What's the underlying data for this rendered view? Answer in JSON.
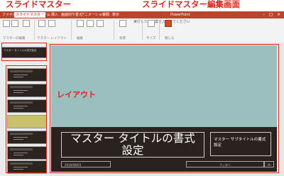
{
  "annotations": {
    "slide_master": "スライドマスター",
    "slide_master_editor": "スライドマスター編集画面",
    "layout": "レイアウト"
  },
  "ribbon": {
    "tabs": [
      "ファイル",
      "スライドマスター",
      "ホーム",
      "挿入",
      "画面切り替え",
      "アニメーション",
      "校閲",
      "表示"
    ],
    "active_tab_index": 1,
    "window_title": "PowerPoint",
    "tell_me": "実行したい作業を入力してください",
    "groups": [
      "マスターの編集",
      "マスター レイアウト",
      "編集",
      "背景",
      "サイズ",
      "閉じる"
    ]
  },
  "thumbnails": {
    "master_label": "マスター タイトルの書式設定",
    "layout_count": 7,
    "accent_index": 3
  },
  "slide": {
    "title": "マスター タイトルの書式\n設定",
    "subtitle": "マスター サブタイトルの書式設定",
    "date_placeholder": "2016/08/03",
    "footer": "フッター",
    "page_number": "‹#›"
  },
  "colors": {
    "accent": "#d7261e",
    "ribbon": "#b7472a",
    "slide_top": "#9abfbe",
    "slide_bottom": "#2a221e"
  }
}
